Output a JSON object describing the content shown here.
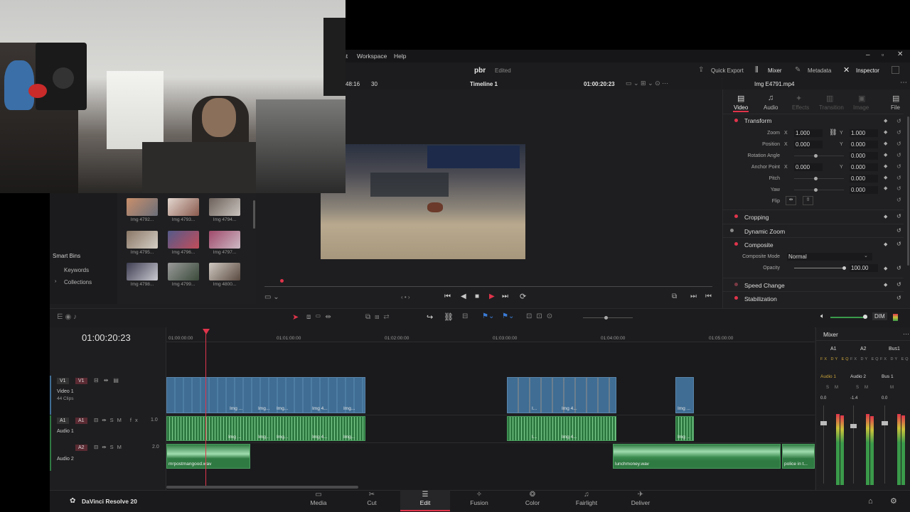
{
  "menu": {
    "partial_item": "ht",
    "workspace": "Workspace",
    "help": "Help"
  },
  "header": {
    "project": "pbr",
    "status": "Edited",
    "quick_export": "Quick Export",
    "mixer": "Mixer",
    "metadata": "Metadata",
    "inspector": "Inspector"
  },
  "viewer": {
    "source_tc_partial": "48:16",
    "fps": "30",
    "timeline_name": "Timeline 1",
    "timecode": "01:00:20:23",
    "clip_name": "Img E4791.mp4"
  },
  "media_pool": {
    "smart_bins": "Smart Bins",
    "keywords": "Keywords",
    "collections": "Collections",
    "clips": [
      "Img 4792...",
      "Img 4793...",
      "Img 4794...",
      "Img 4795...",
      "Img 4796...",
      "Img 4797...",
      "Img 4798...",
      "Img 4799...",
      "Img 4800..."
    ]
  },
  "inspector": {
    "tabs": [
      "Video",
      "Audio",
      "Effects",
      "Transition",
      "Image",
      "File"
    ],
    "transform": "Transform",
    "zoom_label": "Zoom",
    "zoom_x": "1.000",
    "zoom_y": "1.000",
    "position_label": "Position",
    "pos_x": "0.000",
    "pos_y": "0.000",
    "rotation_label": "Rotation Angle",
    "rotation": "0.000",
    "anchor_label": "Anchor Point",
    "anchor_x": "0.000",
    "anchor_y": "0.000",
    "pitch_label": "Pitch",
    "pitch": "0.000",
    "yaw_label": "Yaw",
    "yaw": "0.000",
    "flip_label": "Flip",
    "x": "X",
    "y": "Y",
    "cropping": "Cropping",
    "dynamic_zoom": "Dynamic Zoom",
    "composite": "Composite",
    "composite_mode_label": "Composite Mode",
    "composite_mode": "Normal",
    "opacity_label": "Opacity",
    "opacity": "100.00",
    "speed_change": "Speed Change",
    "stabilization": "Stabilization"
  },
  "timeline": {
    "timecode": "01:00:20:23",
    "ruler": [
      "01:00:00:00",
      "01:01:00:00",
      "01:02:00:00",
      "01:03:00:00",
      "01:04:00:00",
      "01:05:00:00"
    ],
    "v1": {
      "tag": "V1",
      "name": "Video 1",
      "count": "44 Clips"
    },
    "a1": {
      "tag": "A1",
      "name": "Audio 1",
      "vol": "1.0"
    },
    "a2": {
      "tag": "A2",
      "name": "Audio 2",
      "vol": "2.0"
    },
    "clip_labels": {
      "img_short": "Img ...",
      "img_mid": "Img...",
      "img_4": "Img 4...",
      "img_l": "I...",
      "img_4b": "Img 4..."
    },
    "audio_files": {
      "a": "mrpostmangood.wav",
      "b": "lunchmoney.wav",
      "c": "police in t..."
    }
  },
  "mixer": {
    "title": "Mixer",
    "channels": [
      "A1",
      "A2",
      "Bus1"
    ],
    "routes": [
      "Audio 1",
      "Audio 2",
      "Bus 1"
    ],
    "values": [
      "0.0",
      "-1.4",
      "0.0"
    ],
    "dim": "DIM"
  },
  "footer": {
    "app": "DaVinci Resolve 20",
    "pages": [
      "Media",
      "Cut",
      "Edit",
      "Fusion",
      "Color",
      "Fairlight",
      "Deliver"
    ]
  },
  "colors": {
    "accent_red": "#e0344b",
    "video_clip": "#3f6d94",
    "audio_clip": "#2f7a42"
  }
}
